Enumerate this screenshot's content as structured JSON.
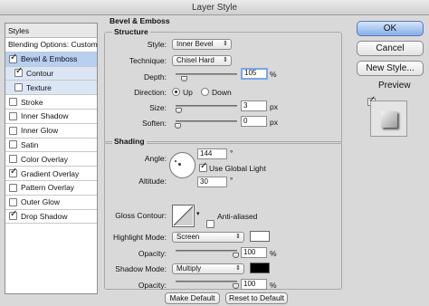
{
  "window": {
    "title": "Layer Style"
  },
  "sidebar": {
    "header": "Styles",
    "items": [
      {
        "label": "Blending Options: Custom",
        "checked": null
      },
      {
        "label": "Bevel & Emboss",
        "checked": true
      },
      {
        "label": "Contour",
        "checked": true
      },
      {
        "label": "Texture",
        "checked": false
      },
      {
        "label": "Stroke",
        "checked": false
      },
      {
        "label": "Inner Shadow",
        "checked": false
      },
      {
        "label": "Inner Glow",
        "checked": false
      },
      {
        "label": "Satin",
        "checked": false
      },
      {
        "label": "Color Overlay",
        "checked": false
      },
      {
        "label": "Gradient Overlay",
        "checked": true
      },
      {
        "label": "Pattern Overlay",
        "checked": false
      },
      {
        "label": "Outer Glow",
        "checked": false
      },
      {
        "label": "Drop Shadow",
        "checked": true
      }
    ]
  },
  "bevel": {
    "title": "Bevel & Emboss",
    "structure": {
      "title": "Structure",
      "style_label": "Style:",
      "style_value": "Inner Bevel",
      "technique_label": "Technique:",
      "technique_value": "Chisel Hard",
      "depth_label": "Depth:",
      "depth_value": "105",
      "depth_unit": "%",
      "depth_level": 0.105,
      "direction_label": "Direction:",
      "dir_up": "Up",
      "dir_down": "Down",
      "size_label": "Size:",
      "size_value": "3",
      "size_unit": "px",
      "size_level": 0.012,
      "soften_label": "Soften:",
      "soften_value": "0",
      "soften_unit": "px",
      "soften_level": 0.0
    },
    "shading": {
      "title": "Shading",
      "angle_label": "Angle:",
      "angle_value": "144",
      "angle_unit": "°",
      "global_light_label": "Use Global Light",
      "altitude_label": "Altitude:",
      "altitude_value": "30",
      "altitude_unit": "°",
      "gloss_label": "Gloss Contour:",
      "anti_aliased_label": "Anti-aliased",
      "highlight_mode_label": "Highlight Mode:",
      "highlight_mode_value": "Screen",
      "highlight_color": "#ffffff",
      "opacity_label": "Opacity:",
      "highlight_opacity": "100",
      "opacity_unit": "%",
      "highlight_opacity_level": 1.0,
      "shadow_mode_label": "Shadow Mode:",
      "shadow_mode_value": "Multiply",
      "shadow_color": "#000000",
      "shadow_opacity": "100",
      "shadow_opacity_level": 1.0
    },
    "make_default": "Make Default",
    "reset_default": "Reset to Default"
  },
  "actions": {
    "ok": "OK",
    "cancel": "Cancel",
    "new_style": "New Style...",
    "preview": "Preview"
  }
}
